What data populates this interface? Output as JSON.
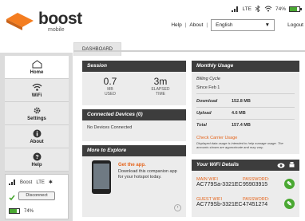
{
  "brand": {
    "name": "boost",
    "sub": "mobile"
  },
  "status": {
    "network": "LTE",
    "battery": "74%",
    "battery_level": 0.74
  },
  "header": {
    "help": "Help",
    "about": "About",
    "language": "English",
    "logout": "Logout",
    "sep": "|"
  },
  "tabs": [
    {
      "label": "DASHBOARD"
    }
  ],
  "nav": [
    {
      "label": "Home",
      "icon": "home-icon",
      "active": true
    },
    {
      "label": "WiFi",
      "icon": "wifi-icon"
    },
    {
      "label": "Settings",
      "icon": "gear-icon"
    },
    {
      "label": "About",
      "icon": "info-icon"
    },
    {
      "label": "Help",
      "icon": "help-icon"
    }
  ],
  "device_status": {
    "name": "Boost",
    "network": "LTE",
    "disconnect": "Disconnect",
    "battery": "74%"
  },
  "session": {
    "title": "Session",
    "used": "0.7",
    "used_unit": "MB",
    "used_label": "USED",
    "elapsed": "3m",
    "elapsed_label1": "ELAPSED",
    "elapsed_label2": "TIME"
  },
  "devices": {
    "title": "Connected Devices (0)",
    "empty": "No Devices Connected"
  },
  "explore": {
    "title": "More to Explore",
    "app_title": "Get the app.",
    "app_desc": "Download this companion app for your hotspot today."
  },
  "usage": {
    "title": "Monthly Usage",
    "cycle_label": "Billing Cycle",
    "cycle_value": "Since Feb 1",
    "download_label": "Download",
    "download_value": "152.8 MB",
    "upload_label": "Upload",
    "upload_value": "4.6 MB",
    "total_label": "Total",
    "total_value": "157.4 MB",
    "link": "Check Carrier Usage",
    "note": "Displayed data usage is intended to help manage usage. The amounts shown are approximate and may vary."
  },
  "wifi": {
    "title": "Your WiFi Details",
    "networks": [
      {
        "label": "MAIN WIFI",
        "ssid": "AC779Sa-3321EC",
        "pw_label": "PASSWORD:",
        "password": "95903915"
      },
      {
        "label": "GUEST WIFI",
        "ssid": "AC779Sb-3321EC",
        "pw_label": "PASSWORD:",
        "password": "47451274"
      }
    ]
  },
  "colors": {
    "accent": "#e5641b",
    "dark": "#3d3d3d",
    "green": "#4aa832"
  }
}
